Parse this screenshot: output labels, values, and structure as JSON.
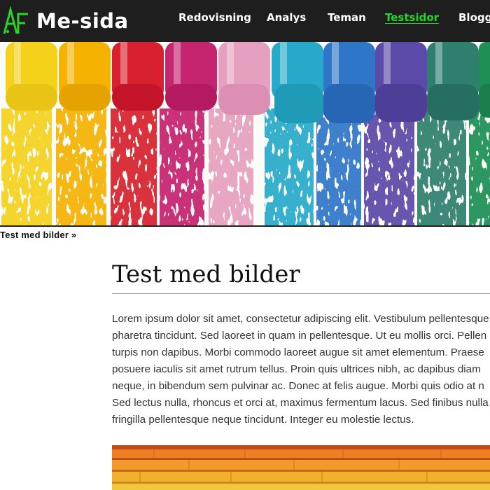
{
  "header": {
    "logo_text": "Me-sida",
    "nav": [
      {
        "label": "Redovisning",
        "active": false
      },
      {
        "label": "Analys",
        "active": false
      },
      {
        "label": "Teman",
        "active": false
      },
      {
        "label": "Testsidor",
        "active": true
      },
      {
        "label": "Blogg",
        "active": false
      }
    ]
  },
  "breadcrumb": "Test med bilder »",
  "main": {
    "title": "Test med bilder",
    "paragraph_lines": [
      "Lorem ipsum dolor sit amet, consectetur adipiscing elit. Vestibulum pellentesque",
      "pharetra tincidunt. Sed laoreet in quam in pellentesque. Ut eu mollis orci. Pellen",
      "turpis non dapibus. Morbi commodo laoreet augue sit amet elementum. Praese",
      "posuere iaculis sit amet rutrum tellus. Proin quis ultrices nibh, ac dapibus diam",
      "neque, in bibendum sem pulvinar ac. Donec at felis augue. Morbi quis odio at n",
      "Sed lectus nulla, rhoncus et orci at, maximus fermentum lacus. Sed finibus nulla",
      "fringilla pellentesque neque tincidunt. Integer eu molestie lectus."
    ]
  },
  "colors": {
    "header_bg": "#1e1e1e",
    "nav_active": "#2bd32b",
    "logo_green": "#2bd32b",
    "crayons": [
      "#f4d11a",
      "#f5b200",
      "#d8202e",
      "#c5246e",
      "#e6a0bf",
      "#27aac9",
      "#2f76c8",
      "#5b4aa8",
      "#2e7f6e",
      "#1f8f55"
    ]
  }
}
